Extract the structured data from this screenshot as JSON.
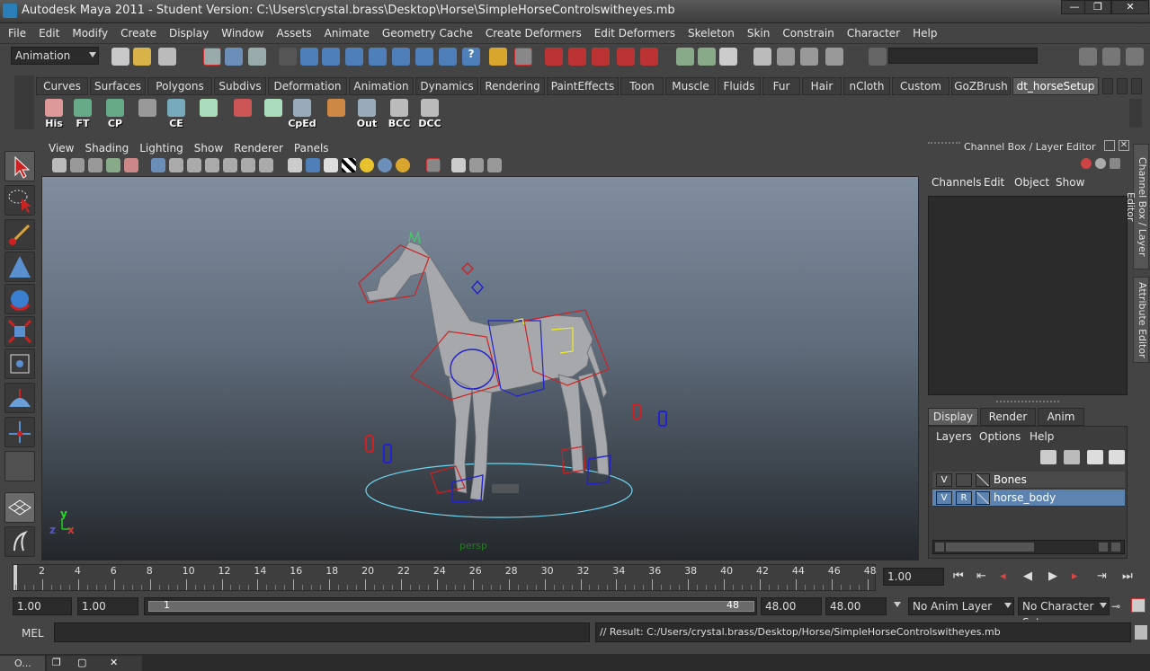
{
  "window": {
    "title": "Autodesk Maya 2011 - Student Version: C:\\Users\\crystal.brass\\Desktop\\Horse\\SimpleHorseControlswitheyes.mb",
    "min_glyph": "—",
    "max_glyph": "❐",
    "close_glyph": "✕"
  },
  "menubar": [
    "File",
    "Edit",
    "Modify",
    "Create",
    "Display",
    "Window",
    "Assets",
    "Animate",
    "Geometry Cache",
    "Create Deformers",
    "Edit Deformers",
    "Skeleton",
    "Skin",
    "Constrain",
    "Character",
    "Help"
  ],
  "statusline": {
    "menuset": "Animation"
  },
  "shelf_tabs": [
    "Curves",
    "Surfaces",
    "Polygons",
    "Subdivs",
    "Deformation",
    "Animation",
    "Dynamics",
    "Rendering",
    "PaintEffects",
    "Toon",
    "Muscle",
    "Fluids",
    "Fur",
    "Hair",
    "nCloth",
    "Custom",
    "GoZBrush",
    "dt_horseSetup"
  ],
  "shelf_buttons": [
    "His",
    "FT",
    "CP",
    "",
    "CE",
    "",
    "",
    "",
    "CpEd",
    "",
    "Out",
    "BCC",
    "DCC"
  ],
  "panel_menu": [
    "View",
    "Shading",
    "Lighting",
    "Show",
    "Renderer",
    "Panels"
  ],
  "viewport": {
    "camera_label": "persp",
    "axis_x": "x",
    "axis_y": "y",
    "axis_z": "z"
  },
  "channel_box": {
    "title": "Channel Box / Layer Editor",
    "menu": [
      "Channels",
      "Edit",
      "Object",
      "Show"
    ],
    "layer_tabs": [
      "Display",
      "Render",
      "Anim"
    ],
    "layer_menu": [
      "Layers",
      "Options",
      "Help"
    ],
    "layers": [
      {
        "v": "V",
        "r": "",
        "name": "Bones",
        "selected": false
      },
      {
        "v": "V",
        "r": "R",
        "name": "horse_body",
        "selected": true
      }
    ]
  },
  "side_tabs": [
    "Channel Box / Layer Editor",
    "Attribute Editor"
  ],
  "time_slider": {
    "ticks": [
      "2",
      "4",
      "6",
      "8",
      "10",
      "12",
      "14",
      "16",
      "18",
      "20",
      "22",
      "24",
      "26",
      "28",
      "30",
      "32",
      "34",
      "36",
      "38",
      "40",
      "42",
      "44",
      "46",
      "48"
    ],
    "current_time": "1.00"
  },
  "range": {
    "start": "1.00",
    "playback_start": "1.00",
    "slider_left": "1",
    "slider_right": "48",
    "playback_end": "48.00",
    "end": "48.00",
    "anim_layer": "No Anim Layer",
    "character_set": "No Character Set"
  },
  "command_line": {
    "label": "MEL",
    "result": "// Result: C:/Users/crystal.brass/Desktop/Horse/SimpleHorseControlswitheyes.mb"
  },
  "taskbar": {
    "item": "O..."
  },
  "colors": {
    "accent": "#5d84b1",
    "panel": "#444444",
    "dark": "#2b2b2b"
  }
}
